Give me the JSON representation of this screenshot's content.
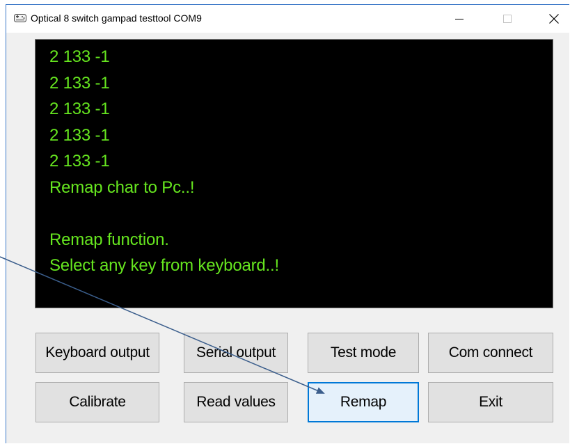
{
  "window": {
    "title": "Optical 8 switch gampad testtool  COM9",
    "icon": "gamepad-icon",
    "controls": {
      "minimize": "minimize-icon",
      "maximize": "maximize-icon",
      "close": "close-icon"
    }
  },
  "console": {
    "text_color": "#66e61f",
    "background": "#000000",
    "lines": [
      "2 133 -1",
      "2 133 -1",
      "2 133 -1",
      "2 133 -1",
      "2 133 -1",
      "Remap char to Pc..!",
      "",
      "Remap function.",
      "Select any key from keyboard..!"
    ]
  },
  "buttons": {
    "keyboard_output": "Keyboard output",
    "serial_output": "Serial output",
    "test_mode": "Test mode",
    "com_connect": "Com connect",
    "calibrate": "Calibrate",
    "read_values": "Read values",
    "remap": "Remap",
    "exit": "Exit"
  },
  "focused_button": "remap",
  "accent_color": "#0078d7",
  "annotation_arrow_color": "#3b5e8c"
}
